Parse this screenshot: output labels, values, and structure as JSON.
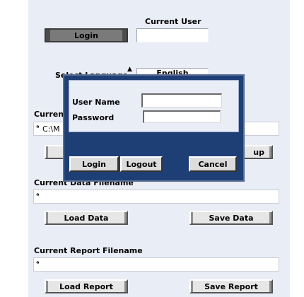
{
  "main": {
    "current_user_label": "Current User",
    "current_user_value": "",
    "login_button": "Login",
    "select_language_label": "Select Language",
    "language_value": "English",
    "current_path_label": "Current",
    "current_path_value": "C:\\M",
    "setup_button_partial": "up",
    "current_data_filename_label": "Current Data Filename",
    "current_data_filename_value": "",
    "load_data_button": "Load Data",
    "save_data_button": "Save Data",
    "current_report_filename_label": "Current Report Filename",
    "current_report_filename_value": "",
    "load_report_button": "Load Report",
    "save_report_button": "Save Report",
    "path_indicator": "ᵃ"
  },
  "dialog": {
    "username_label": "User Name",
    "username_value": "",
    "password_label": "Password",
    "password_value": "",
    "login_button": "Login",
    "logout_button": "Logout",
    "cancel_button": "Cancel"
  }
}
